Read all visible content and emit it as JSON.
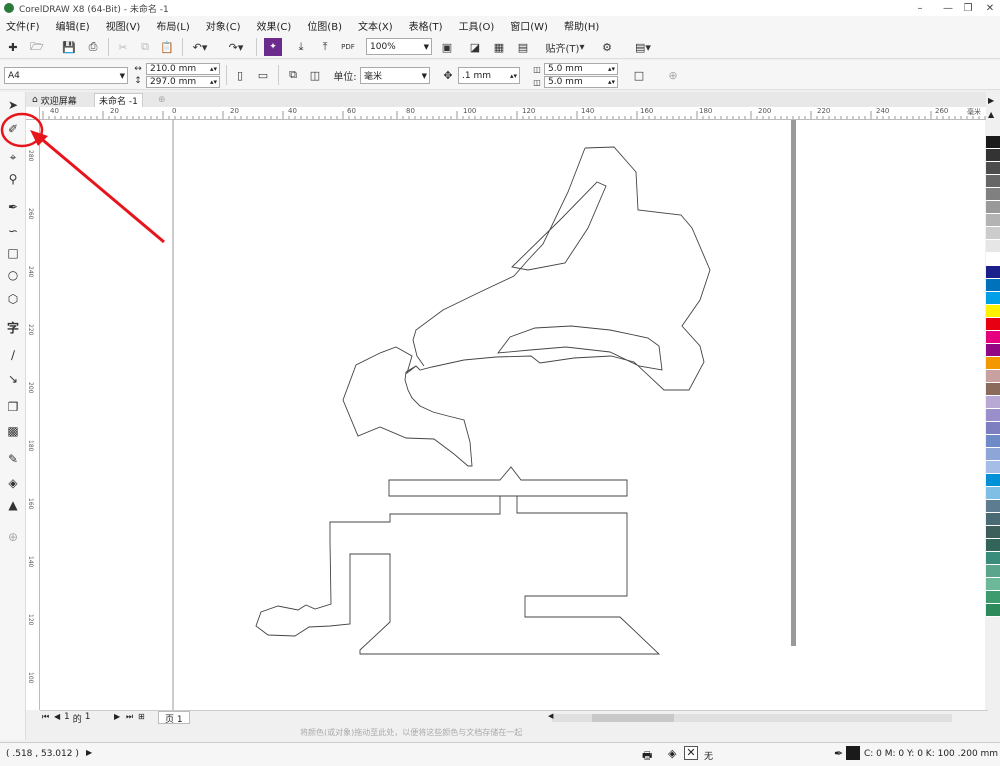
{
  "window": {
    "title": "CorelDRAW X8 (64-Bit) - 未命名 -1"
  },
  "menu": [
    "文件(F)",
    "编辑(E)",
    "视图(V)",
    "布局(L)",
    "对象(C)",
    "效果(C)",
    "位图(B)",
    "文本(X)",
    "表格(T)",
    "工具(O)",
    "窗口(W)",
    "帮助(H)"
  ],
  "toolbar": {
    "zoom": "100%",
    "snap_label": "贴齐(T)",
    "pdf_label": "PDF"
  },
  "propertybar": {
    "page_size": "A4",
    "width": "210.0 mm",
    "height": "297.0 mm",
    "unit_label": "单位:",
    "unit": "毫米",
    "nudge": ".1 mm",
    "dup_x": "5.0 mm",
    "dup_y": "5.0 mm"
  },
  "tabs": {
    "welcome": "欢迎屏幕",
    "document": "未命名 -1"
  },
  "ruler": {
    "h_ticks": [
      "40",
      "20",
      "0",
      "20",
      "40",
      "60",
      "80",
      "100",
      "120",
      "140",
      "160",
      "180",
      "200",
      "220",
      "240",
      "260",
      "毫米"
    ],
    "v_ticks": [
      "280",
      "260",
      "240",
      "220",
      "200",
      "180",
      "160",
      "140",
      "120",
      "100",
      "80",
      "60",
      "40",
      "20"
    ]
  },
  "pagenav": {
    "current": "1",
    "of_label": "的",
    "total": "1",
    "page_tab": "页 1"
  },
  "hint": "将颜色(或对象)拖动至此处，以便将这些颜色与文档存储在一起",
  "status": {
    "coords": "( .518 , 53.012 )",
    "fill_label": "无",
    "outline_info": "C: 0 M: 0 Y: 0 K: 100  .200 mm"
  },
  "colors": {
    "annotation": "#e8141c",
    "outline_swatch": "#1a1a1a"
  },
  "palette": [
    "#1a1a1a",
    "#333333",
    "#4d4d4d",
    "#666666",
    "#808080",
    "#999999",
    "#b3b3b3",
    "#cccccc",
    "#e6e6e6",
    "#ffffff",
    "#1b1f8a",
    "#0072bc",
    "#00a0e9",
    "#fff200",
    "#e60012",
    "#e4007f",
    "#920783",
    "#f39800",
    "#c8a0a0",
    "#8b6c5c",
    "#b8a9d4",
    "#9a8fcb",
    "#7d7fc0",
    "#6e8bc7",
    "#8ea5d8",
    "#a6bde8",
    "#0091d6",
    "#7fbfe6",
    "#5d7c8f",
    "#4b6b74",
    "#3c5f5b",
    "#32645a",
    "#3a8d7a",
    "#5aa58c",
    "#6eb89a",
    "#3e9b6e",
    "#2d8a5a"
  ],
  "icons": {
    "select": "pointer-icon",
    "freehand": "freehand-tool-icon",
    "crop": "crop-icon",
    "zoom": "zoom-icon",
    "settings": "gear-icon"
  }
}
